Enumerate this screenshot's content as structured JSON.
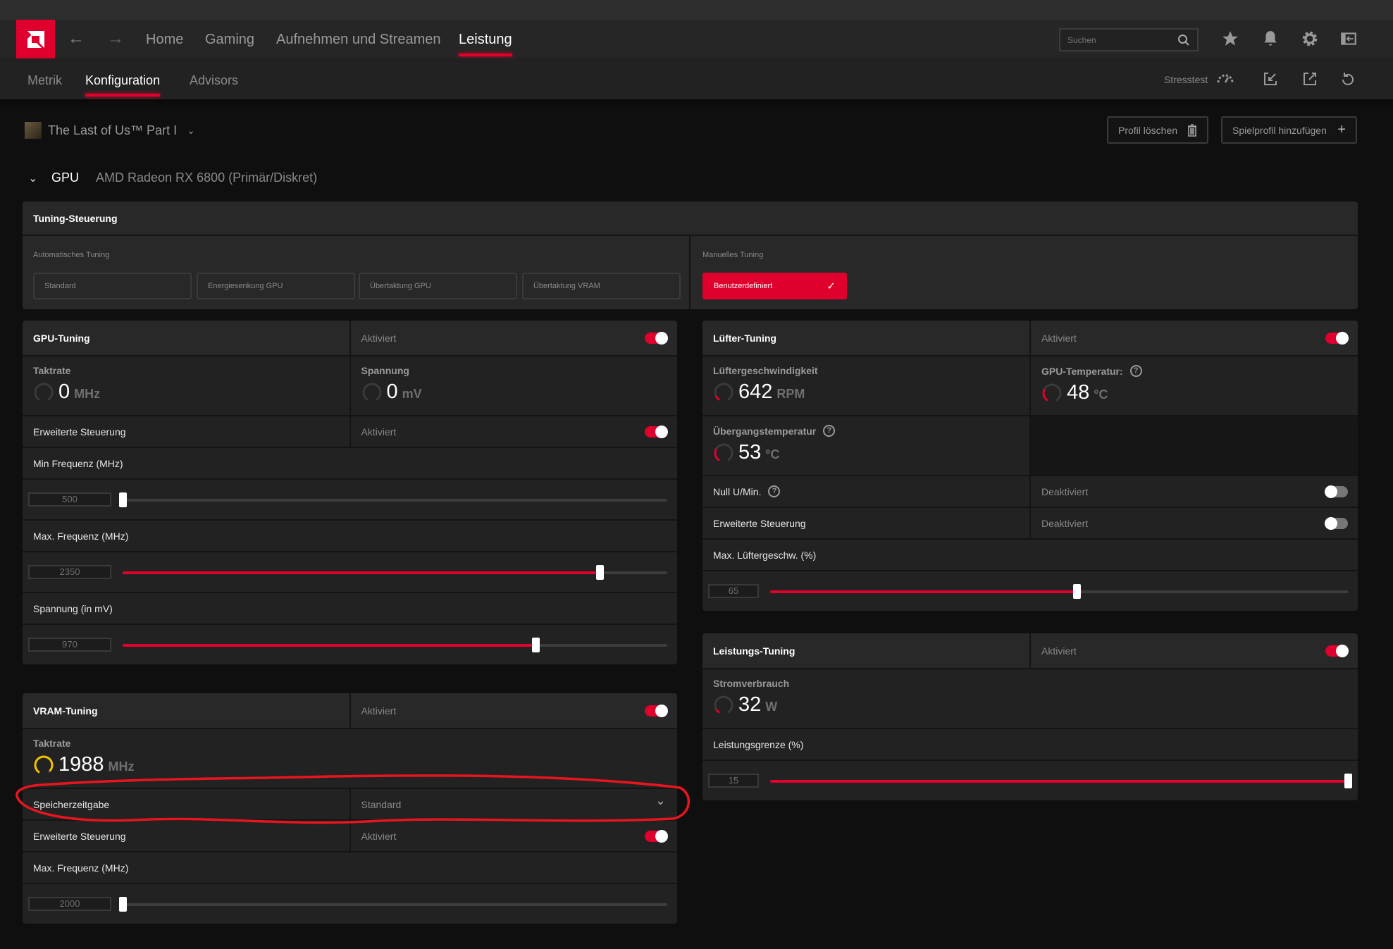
{
  "colors": {
    "accent": "#e0002d",
    "vram_gauge": "#f2c200",
    "background": "#0f0f0f",
    "panel": "#282828"
  },
  "nav": {
    "logo": "AMD",
    "back_icon": "arrow-left-icon",
    "forward_icon": "arrow-right-icon",
    "links": [
      {
        "label": "Home"
      },
      {
        "label": "Gaming"
      },
      {
        "label": "Aufnehmen und Streamen"
      },
      {
        "label": "Leistung",
        "active": true
      }
    ],
    "search_placeholder": "Suchen"
  },
  "subnav": {
    "tabs": [
      {
        "label": "Metrik"
      },
      {
        "label": "Konfiguration",
        "active": true
      },
      {
        "label": "Advisors"
      }
    ],
    "stresstest_label": "Stresstest"
  },
  "profile": {
    "game": "The Last of Us™ Part I",
    "delete_label": "Profil löschen",
    "add_label": "Spielprofil hinzufügen"
  },
  "device": {
    "section": "GPU",
    "name": "AMD Radeon RX 6800 (Primär/Diskret)"
  },
  "tuning_control": {
    "title": "Tuning-Steuerung",
    "auto_label": "Automatisches Tuning",
    "auto_options": [
      "Standard",
      "Energiesenkung GPU",
      "Übertaktung GPU",
      "Übertaktung VRAM"
    ],
    "manual_label": "Manuelles Tuning",
    "manual_option": "Benutzerdefiniert",
    "manual_selected": true
  },
  "panels": [
    {
      "id": "gpu",
      "rows": [
        {
          "type": "head",
          "title": "GPU-Tuning",
          "status": "Aktiviert",
          "on": true
        },
        {
          "type": "gauge",
          "items": [
            {
              "label": "Taktrate",
              "value": "0",
              "unit": "MHz",
              "level": 0
            },
            {
              "label": "Spannung",
              "value": "0",
              "unit": "mV",
              "level": 0
            }
          ]
        },
        {
          "type": "toggle",
          "label": "Erweiterte Steuerung",
          "status": "Aktiviert",
          "on": true
        },
        {
          "type": "label",
          "label": "Min Frequenz (MHz)"
        },
        {
          "type": "slider",
          "value": "500",
          "fraction": 0
        },
        {
          "type": "label",
          "label": "Max. Frequenz (MHz)"
        },
        {
          "type": "slider",
          "value": "2350",
          "fraction": 0.876
        },
        {
          "type": "label",
          "label": "Spannung (in mV)"
        },
        {
          "type": "slider",
          "value": "970",
          "fraction": 0.758
        }
      ]
    },
    {
      "id": "vram",
      "rows": [
        {
          "type": "head",
          "title": "VRAM-Tuning",
          "status": "Aktiviert",
          "on": true
        },
        {
          "type": "gauge",
          "items": [
            {
              "label": "Taktrate",
              "value": "1988",
              "unit": "MHz",
              "level": 0.95,
              "color": "#f2c200"
            }
          ]
        },
        {
          "type": "dropdown",
          "label": "Speicherzeitgabe",
          "value": "Standard"
        },
        {
          "type": "toggle",
          "label": "Erweiterte Steuerung",
          "status": "Aktiviert",
          "on": true
        },
        {
          "type": "label",
          "label": "Max. Frequenz (MHz)"
        },
        {
          "type": "slider",
          "value": "2000",
          "fraction": 0
        }
      ]
    },
    {
      "id": "fan",
      "rows": [
        {
          "type": "head",
          "title": "Lüfter-Tuning",
          "status": "Aktiviert",
          "on": true
        },
        {
          "type": "gauge",
          "items": [
            {
              "label": "Lüftergeschwindigkeit",
              "value": "642",
              "unit": "RPM",
              "level": 0.12
            },
            {
              "label": "GPU-Temperatur:",
              "help": true,
              "value": "48",
              "unit": "°C",
              "level": 0.3
            }
          ]
        },
        {
          "type": "gauge",
          "half": true,
          "items": [
            {
              "label": "Übergangstemperatur",
              "help": true,
              "value": "53",
              "unit": "°C",
              "level": 0.3
            }
          ]
        },
        {
          "type": "toggle",
          "label": "Null U/Min.",
          "help": true,
          "status": "Deaktiviert",
          "on": false
        },
        {
          "type": "toggle",
          "label": "Erweiterte Steuerung",
          "status": "Deaktiviert",
          "on": false
        },
        {
          "type": "label",
          "label": "Max. Lüftergeschw. (%)"
        },
        {
          "type": "slider",
          "value": "65",
          "fraction": 0.53
        }
      ]
    },
    {
      "id": "power",
      "rows": [
        {
          "type": "head",
          "title": "Leistungs-Tuning",
          "status": "Aktiviert",
          "on": true
        },
        {
          "type": "gauge",
          "items": [
            {
              "label": "Stromverbrauch",
              "value": "32",
              "unit": "W",
              "level": 0.1
            }
          ]
        },
        {
          "type": "label",
          "label": "Leistungsgrenze (%)"
        },
        {
          "type": "slider",
          "value": "15",
          "fraction": 1
        }
      ]
    }
  ]
}
